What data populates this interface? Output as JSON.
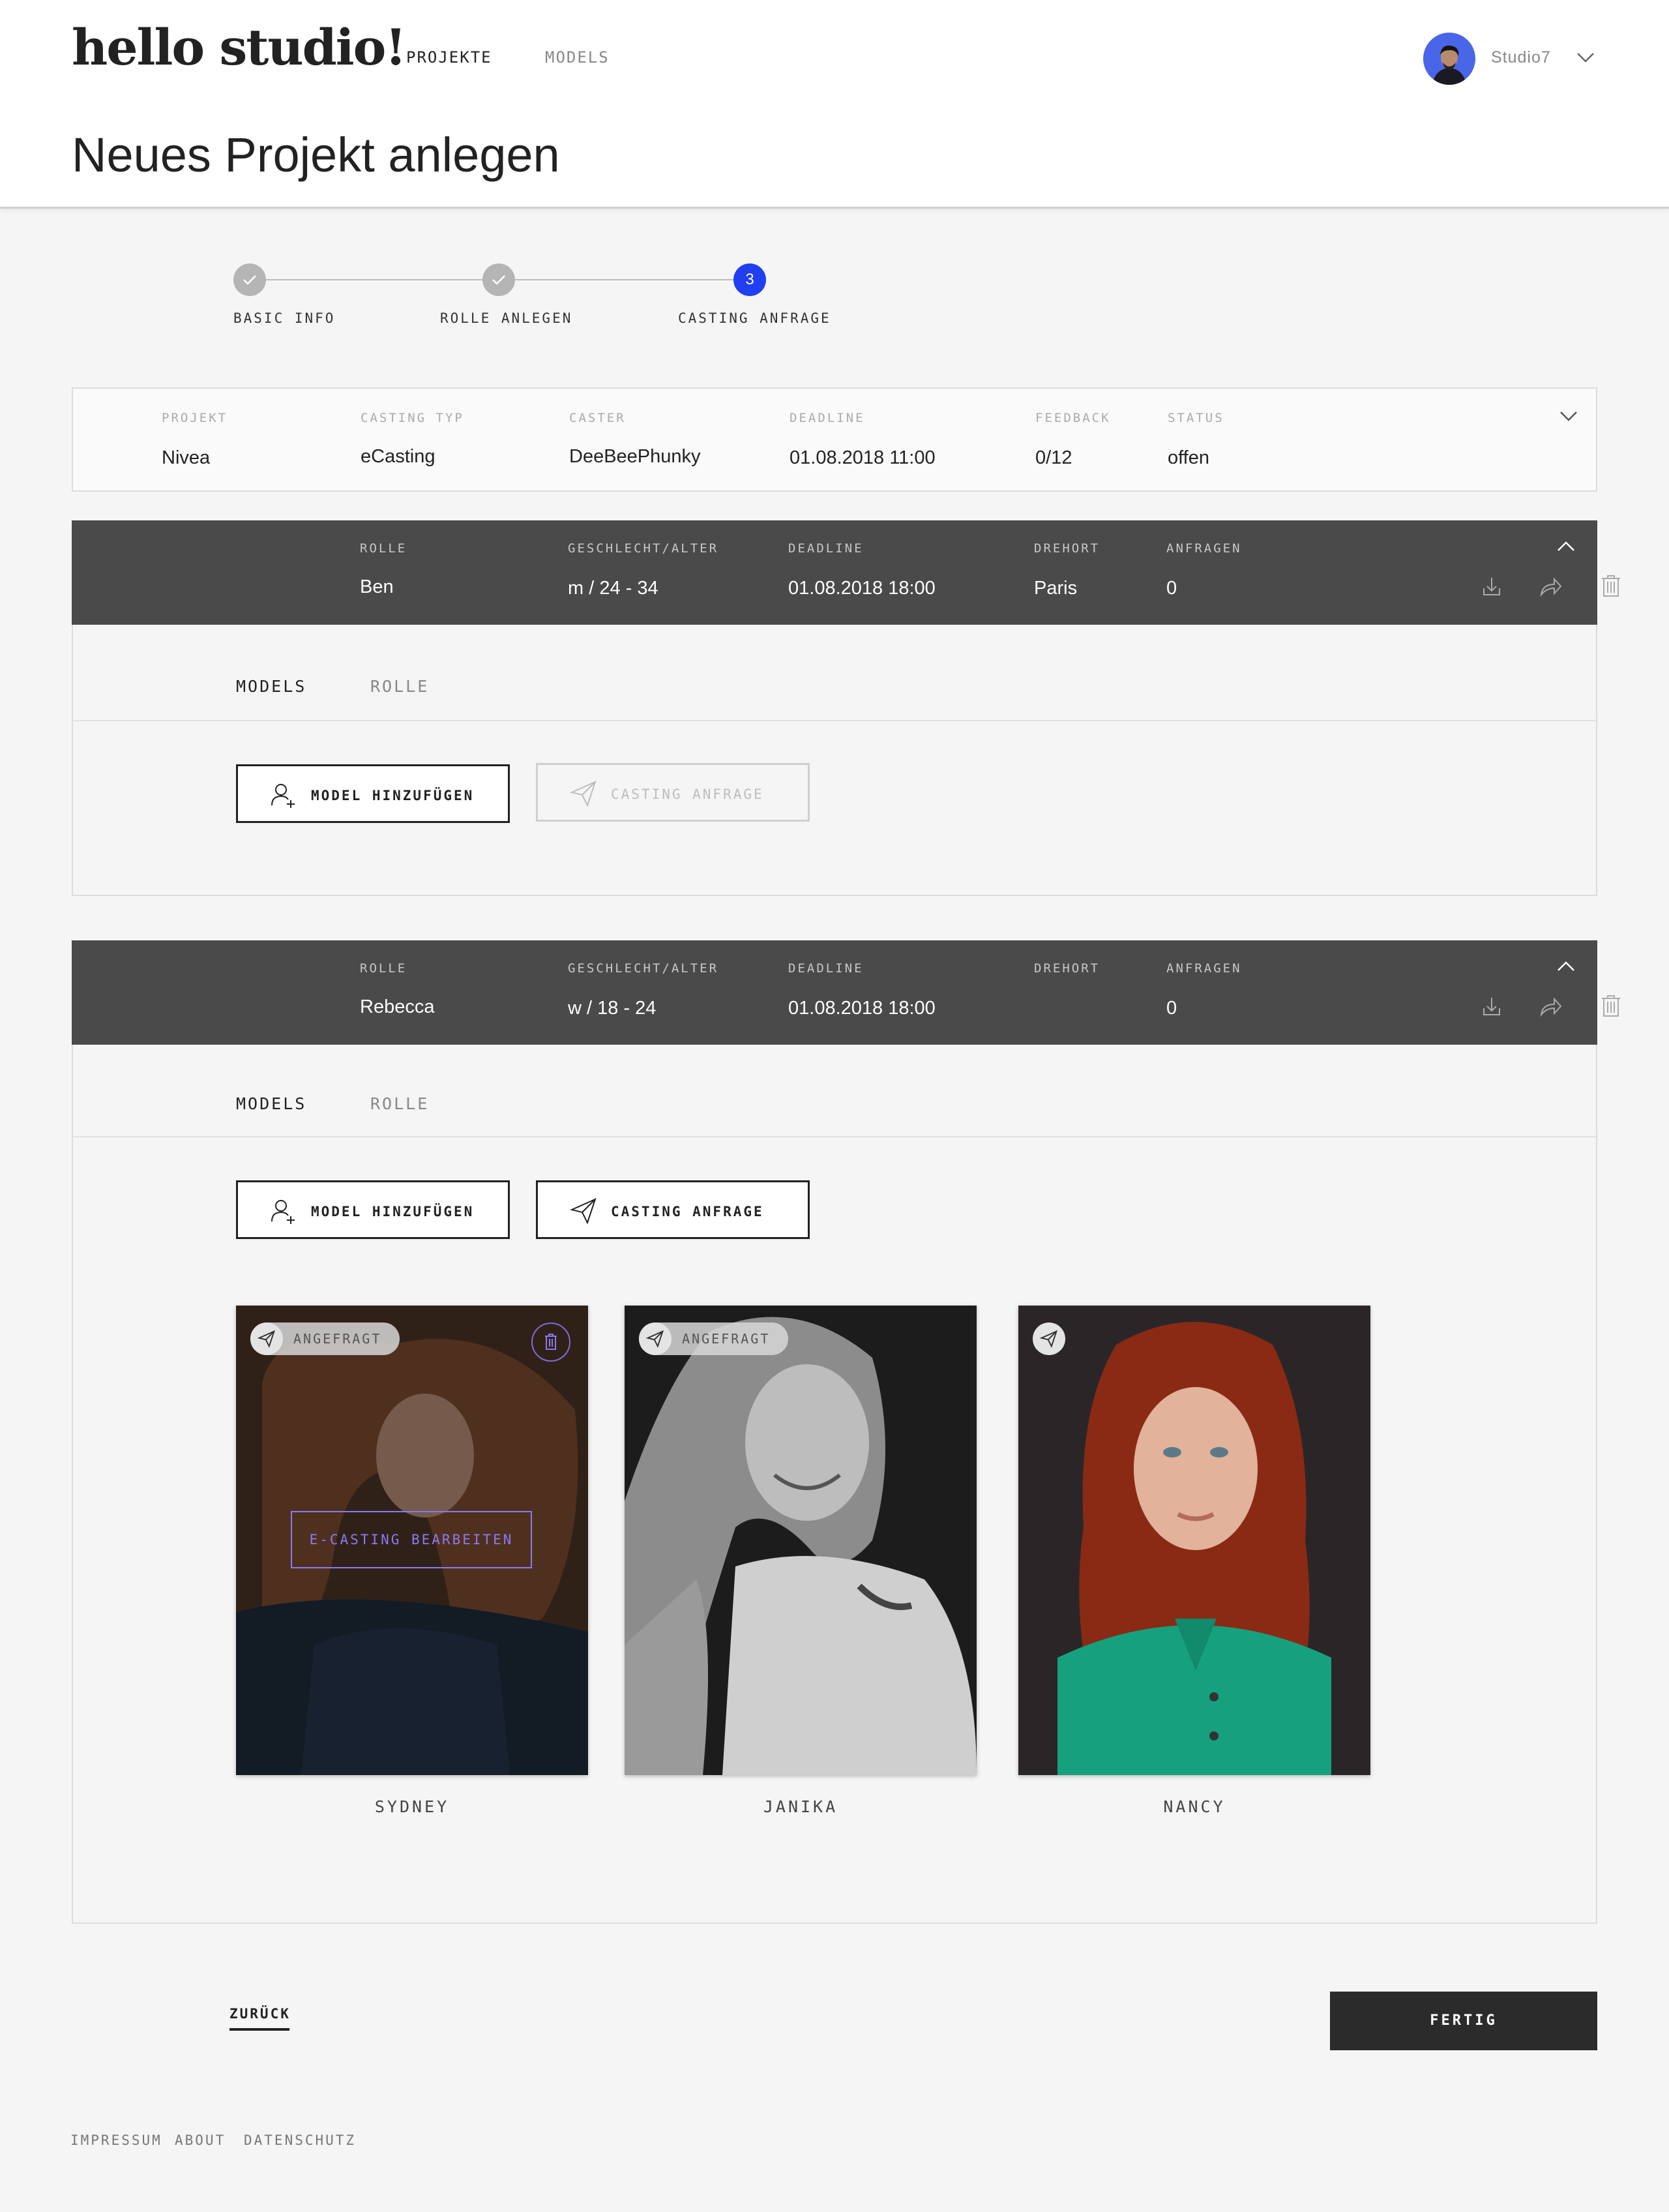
{
  "header": {
    "logo": "hello studio!",
    "nav": {
      "projekte": "PROJEKTE",
      "models": "MODELS"
    },
    "user": {
      "name": "Studio7"
    },
    "page_title": "Neues Projekt anlegen"
  },
  "stepper": {
    "steps": [
      {
        "label": "BASIC INFO",
        "state": "done"
      },
      {
        "label": "ROLLE ANLEGEN",
        "state": "done"
      },
      {
        "label": "CASTING ANFRAGE",
        "state": "active",
        "number": "3"
      }
    ]
  },
  "project": {
    "labels": {
      "projekt": "PROJEKT",
      "casting_typ": "CASTING TYP",
      "caster": "CASTER",
      "deadline": "DEADLINE",
      "feedback": "FEEDBACK",
      "status": "STATUS"
    },
    "values": {
      "projekt": "Nivea",
      "casting_typ": "eCasting",
      "caster": "DeeBeePhunky",
      "deadline": "01.08.2018 11:00",
      "feedback": "0/12",
      "status": "offen"
    }
  },
  "roles": [
    {
      "labels": {
        "rolle": "ROLLE",
        "geschlecht_alter": "GESCHLECHT/ALTER",
        "deadline": "DEADLINE",
        "drehort": "DREHORT",
        "anfragen": "ANFRAGEN"
      },
      "values": {
        "rolle": "Ben",
        "geschlecht_alter": "m / 24 - 34",
        "deadline": "01.08.2018 18:00",
        "drehort": "Paris",
        "anfragen": "0"
      },
      "tabs": {
        "models": "MODELS",
        "rolle": "ROLLE"
      },
      "buttons": {
        "add_model": "MODEL HINZUFÜGEN",
        "casting_anfrage": "CASTING ANFRAGE"
      }
    },
    {
      "labels": {
        "rolle": "ROLLE",
        "geschlecht_alter": "GESCHLECHT/ALTER",
        "deadline": "DEADLINE",
        "drehort": "DREHORT",
        "anfragen": "ANFRAGEN"
      },
      "values": {
        "rolle": "Rebecca",
        "geschlecht_alter": "w / 18 - 24",
        "deadline": "01.08.2018 18:00",
        "drehort": "",
        "anfragen": "0"
      },
      "tabs": {
        "models": "MODELS",
        "rolle": "ROLLE"
      },
      "buttons": {
        "add_model": "MODEL HINZUFÜGEN",
        "casting_anfrage": "CASTING ANFRAGE"
      },
      "models": [
        {
          "name": "SYDNEY",
          "badge": "ANGEFRAGT",
          "edit_label": "E-CASTING BEARBEITEN"
        },
        {
          "name": "JANIKA",
          "badge": "ANGEFRAGT"
        },
        {
          "name": "NANCY"
        }
      ]
    }
  ],
  "actions": {
    "back": "ZURÜCK",
    "done": "FERTIG"
  },
  "footer": {
    "impressum": "IMPRESSUM",
    "about": "ABOUT",
    "datenschutz": "DATENSCHUTZ"
  },
  "colors": {
    "accent": "#1f3ff0",
    "edit": "#8b79f0",
    "role_header": "#4a4a4a"
  },
  "icons": [
    "check-icon",
    "chevron-down-icon",
    "chevron-up-icon",
    "download-icon",
    "share-icon",
    "trash-icon",
    "add-user-icon",
    "paper-plane-icon"
  ]
}
